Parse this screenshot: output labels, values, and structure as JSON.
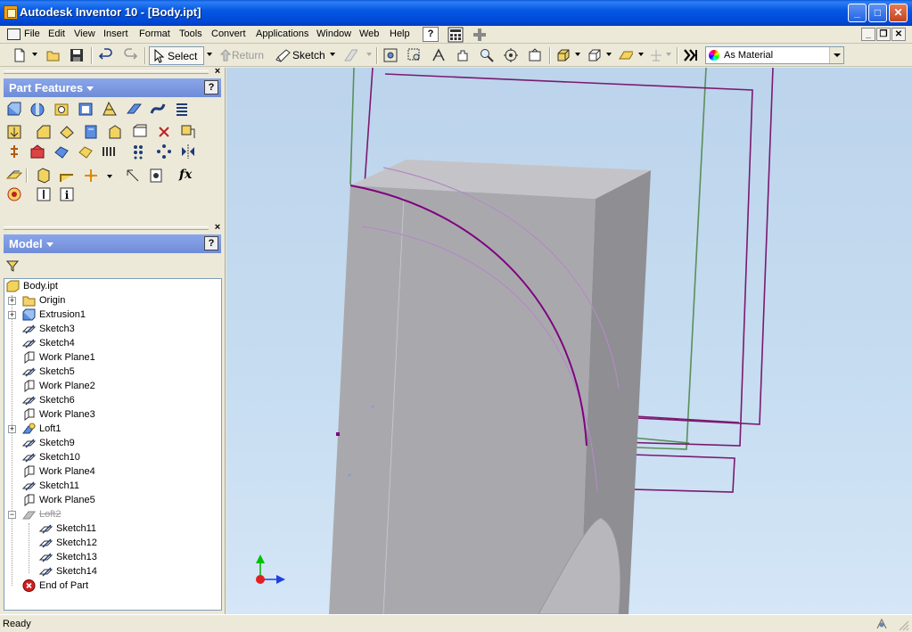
{
  "window": {
    "title": "Autodesk Inventor 10 - [Body.ipt]",
    "minimize_glyph": "_",
    "maximize_glyph": "□",
    "close_glyph": "✕"
  },
  "menubar": {
    "items": [
      "File",
      "Edit",
      "View",
      "Insert",
      "Format",
      "Tools",
      "Convert",
      "Applications",
      "Window",
      "Web",
      "Help"
    ],
    "help_glyph": "?"
  },
  "toolbar": {
    "select_label": "Select",
    "return_label": "Return",
    "sketch_label": "Sketch",
    "material_value": "As Material"
  },
  "part_features": {
    "title": "Part Features",
    "help_glyph": "?",
    "fx_label": "fx"
  },
  "model": {
    "title": "Model",
    "help_glyph": "?",
    "tree": [
      {
        "label": "Body.ipt",
        "icon": "part-icon"
      },
      {
        "label": "Origin",
        "icon": "folder-icon"
      },
      {
        "label": "Extrusion1",
        "icon": "extrusion-icon"
      },
      {
        "label": "Sketch3",
        "icon": "sketch-icon"
      },
      {
        "label": "Sketch4",
        "icon": "sketch-icon"
      },
      {
        "label": "Work Plane1",
        "icon": "work-plane-icon"
      },
      {
        "label": "Sketch5",
        "icon": "sketch-icon"
      },
      {
        "label": "Work Plane2",
        "icon": "work-plane-icon"
      },
      {
        "label": "Sketch6",
        "icon": "sketch-icon"
      },
      {
        "label": "Work Plane3",
        "icon": "work-plane-icon"
      },
      {
        "label": "Loft1",
        "icon": "loft-icon"
      },
      {
        "label": "Sketch9",
        "icon": "sketch-icon"
      },
      {
        "label": "Sketch10",
        "icon": "sketch-icon"
      },
      {
        "label": "Work Plane4",
        "icon": "work-plane-icon"
      },
      {
        "label": "Sketch11",
        "icon": "sketch-icon"
      },
      {
        "label": "Work Plane5",
        "icon": "work-plane-icon"
      },
      {
        "label": "Loft2",
        "icon": "loft-icon",
        "suppressed": true
      },
      {
        "label": "Sketch11",
        "icon": "sketch-icon"
      },
      {
        "label": "Sketch12",
        "icon": "sketch-icon"
      },
      {
        "label": "Sketch13",
        "icon": "sketch-icon"
      },
      {
        "label": "Sketch14",
        "icon": "sketch-icon"
      },
      {
        "label": "End of Part",
        "icon": "end-of-part-icon"
      }
    ]
  },
  "status": {
    "text": "Ready"
  },
  "colors": {
    "titlebar": "#0559e3",
    "panel_header": "#7a96df",
    "viewport_bg": "#c6dcf0",
    "sketch_curve": "#800080",
    "model_gray": "#a9a9ad"
  }
}
